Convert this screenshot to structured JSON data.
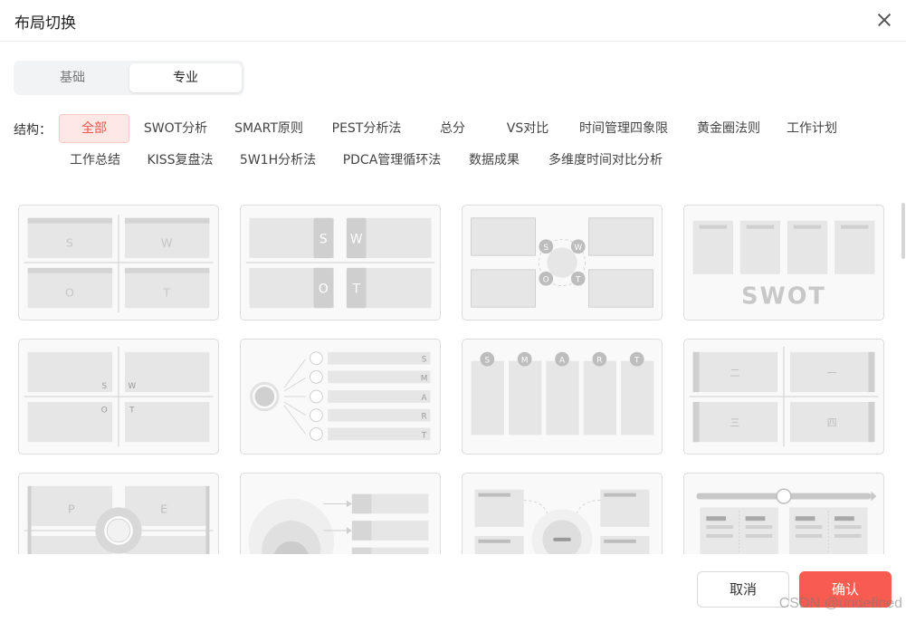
{
  "dialog": {
    "title": "布局切换"
  },
  "tabs": {
    "basic": "基础",
    "pro": "专业",
    "selected": "专业"
  },
  "structure": {
    "label": "结构：",
    "chips": [
      "全部",
      "SWOT分析",
      "SMART原则",
      "PEST分析法",
      "总分",
      "VS对比",
      "时间管理四象限",
      "黄金圈法则",
      "工作计划",
      "工作总结",
      "KISS复盘法",
      "5W1H分析法",
      "PDCA管理循环法",
      "数据成果",
      "多维度时间对比分析"
    ],
    "active": "全部"
  },
  "cards": {
    "c1": [
      "S",
      "W",
      "O",
      "T"
    ],
    "c2": [
      "S",
      "W",
      "O",
      "T"
    ],
    "c3": [
      "S",
      "W",
      "O",
      "T"
    ],
    "c4": [
      "SWOT"
    ],
    "c5": [
      "S",
      "W",
      "O",
      "T"
    ],
    "c6": [
      "S",
      "M",
      "A",
      "R",
      "T"
    ],
    "c7": [
      "S",
      "M",
      "A",
      "R",
      "T"
    ],
    "c8": [
      "二",
      "一",
      "三",
      "四"
    ],
    "c9": [
      "P",
      "E"
    ]
  },
  "footer": {
    "cancel": "取消",
    "confirm": "确认"
  },
  "watermark": "CSDN @undefined",
  "colors": {
    "accent": "#f85c50",
    "chip_active_bg": "#fde8e6",
    "chip_active_text": "#f2564a"
  }
}
